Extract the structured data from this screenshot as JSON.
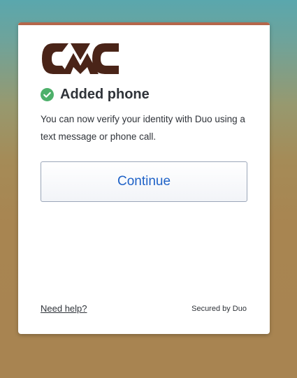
{
  "brand": {
    "logo_icon": "cmc-logo-icon",
    "logo_color": "#4a2418",
    "accent_bar_color": "#b4664a"
  },
  "status": {
    "icon": "check-circle-icon",
    "icon_color": "#4db06a",
    "heading": "Added phone"
  },
  "message": {
    "text": "You can now verify your identity with Duo using a text message or phone call."
  },
  "actions": {
    "continue_label": "Continue"
  },
  "footer": {
    "help_link": "Need help?",
    "secured_by": "Secured by Duo"
  }
}
